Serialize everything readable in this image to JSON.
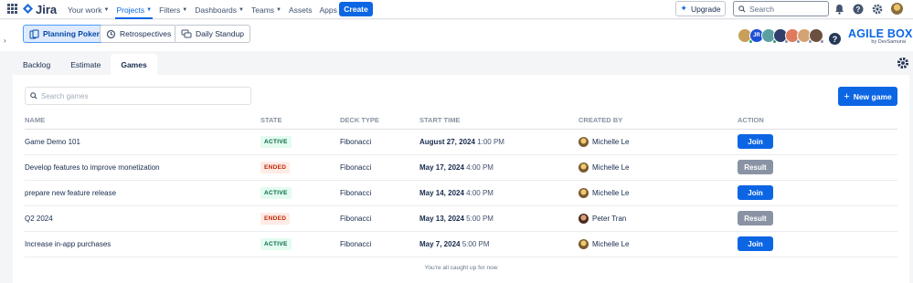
{
  "topnav": {
    "app_name": "Jira",
    "items": [
      {
        "label": "Your work",
        "dropdown": true,
        "active": false
      },
      {
        "label": "Projects",
        "dropdown": true,
        "active": true
      },
      {
        "label": "Filters",
        "dropdown": true,
        "active": false
      },
      {
        "label": "Dashboards",
        "dropdown": true,
        "active": false
      },
      {
        "label": "Teams",
        "dropdown": true,
        "active": false
      },
      {
        "label": "Assets",
        "dropdown": false,
        "active": false
      },
      {
        "label": "Apps",
        "dropdown": true,
        "active": false
      }
    ],
    "create_label": "Create",
    "upgrade_label": "Upgrade",
    "search_placeholder": "Search"
  },
  "toolbar": {
    "buttons": [
      {
        "label": "Planning Poker",
        "icon": "cards-icon",
        "active": true
      },
      {
        "label": "Retrospectives",
        "icon": "retro-icon",
        "active": false
      },
      {
        "label": "Daily Standup",
        "icon": "chat-icon",
        "active": false
      }
    ],
    "brand_title": "AGILE BOX",
    "brand_sub": "by DevSamurai",
    "avatar_initials": "JR"
  },
  "tabs": [
    {
      "label": "Backlog",
      "active": false
    },
    {
      "label": "Estimate",
      "active": false
    },
    {
      "label": "Games",
      "active": true
    }
  ],
  "games": {
    "search_placeholder": "Search games",
    "new_game_label": "New game",
    "columns": [
      "NAME",
      "STATE",
      "DECK TYPE",
      "START TIME",
      "CREATED BY",
      "ACTION"
    ],
    "rows": [
      {
        "name": "Game Demo 101",
        "state": "ACTIVE",
        "deck": "Fibonacci",
        "date": "August 27, 2024",
        "time": "1:00 PM",
        "creator": "Michelle Le",
        "action": "Join"
      },
      {
        "name": "Develop features to improve monetization",
        "state": "ENDED",
        "deck": "Fibonacci",
        "date": "May 17, 2024",
        "time": "4:00 PM",
        "creator": "Michelle Le",
        "action": "Result"
      },
      {
        "name": "prepare new feature release",
        "state": "ACTIVE",
        "deck": "Fibonacci",
        "date": "May 14, 2024",
        "time": "4:00 PM",
        "creator": "Michelle Le",
        "action": "Join"
      },
      {
        "name": "Q2 2024",
        "state": "ENDED",
        "deck": "Fibonacci",
        "date": "May 13, 2024",
        "time": "5:00 PM",
        "creator": "Peter Tran",
        "action": "Result"
      },
      {
        "name": "Increase in-app purchases",
        "state": "ACTIVE",
        "deck": "Fibonacci",
        "date": "May 7, 2024",
        "time": "5:00 PM",
        "creator": "Michelle Le",
        "action": "Join"
      }
    ],
    "footer_note": "You're all caught up for now"
  },
  "colors": {
    "primary": "#0c66e4",
    "active_badge_bg": "#e3fcef",
    "ended_badge_bg": "#ffebe6",
    "result_btn": "#8993a4"
  }
}
